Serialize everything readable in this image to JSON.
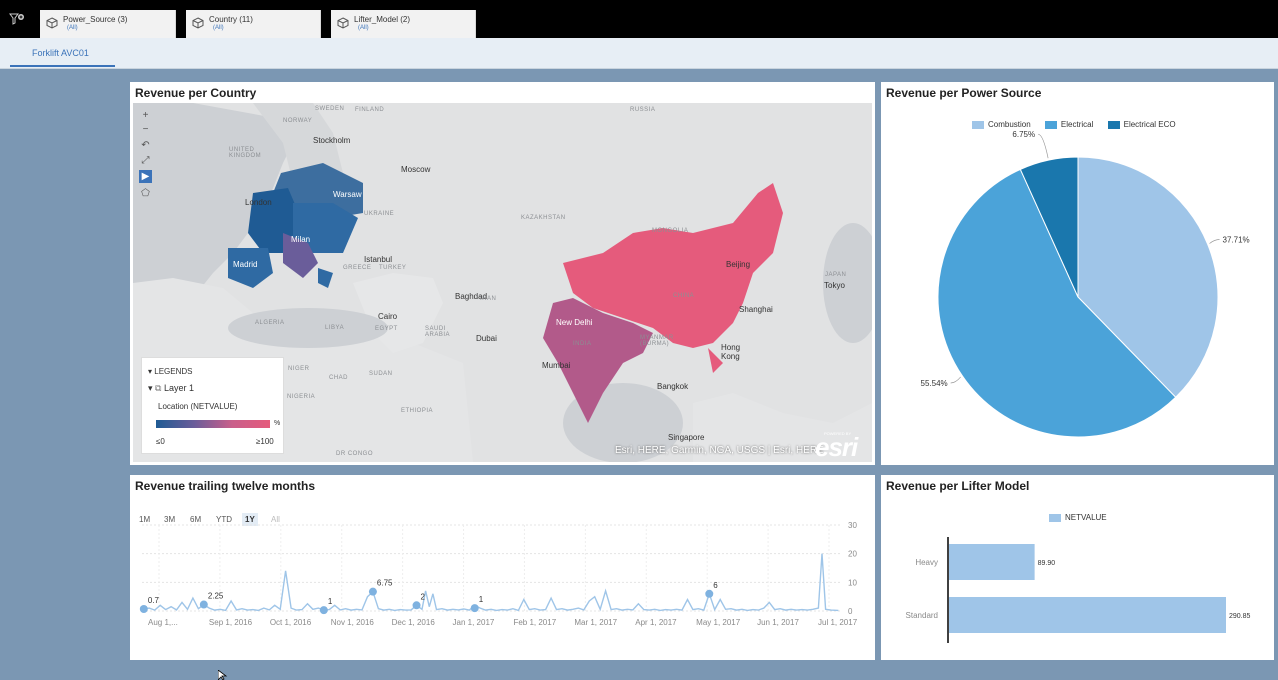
{
  "filters": [
    {
      "name": "Power_Source (3)",
      "value": "(All)"
    },
    {
      "name": "Country (11)",
      "value": "(All)"
    },
    {
      "name": "Lifter_Model (2)",
      "value": "(All)"
    }
  ],
  "tabs": [
    {
      "label": "Forklift AVC01"
    }
  ],
  "map_panel": {
    "title": "Revenue per Country",
    "labels": {
      "sweden": "SWEDEN",
      "finland": "FINLAND",
      "norway": "NORWAY",
      "russia": "RUSSIA",
      "stockholm": "Stockholm",
      "uk": "UNITED KINGDOM",
      "moscow": "Moscow",
      "london": "London",
      "warsaw": "Warsaw",
      "ukraine": "UKRAINE",
      "kazakhstan": "KAZAKHSTAN",
      "mongolia": "MONGOLIA",
      "milan": "Milan",
      "madrid": "Madrid",
      "greece": "GREECE",
      "turkey": "TURKEY",
      "istanbul": "Istanbul",
      "beijing": "Beijing",
      "japan": "JAPAN",
      "tokyo": "Tokyo",
      "baghdad": "Baghdad",
      "iran": "IRAN",
      "algeria": "ALGERIA",
      "libya": "LIBYA",
      "egypt": "EGYPT",
      "cairo": "Cairo",
      "saudi": "SAUDI ARABIA",
      "dubai": "Dubai",
      "china": "CHINA",
      "newdelhi": "New Delhi",
      "shanghai": "Shanghai",
      "india": "INDIA",
      "myanmar": "MYANMAR (BURMA)",
      "hongkong": "Hong Kong",
      "mumbai": "Mumbai",
      "niger": "NIGER",
      "chad": "CHAD",
      "sudan": "SUDAN",
      "nigeria": "NIGERIA",
      "bangkok": "Bangkok",
      "ethiopia": "ETHIOPIA",
      "singapore": "Singapore",
      "drcongo": "DR CONGO"
    },
    "legend": {
      "header": "LEGENDS",
      "layer": "Layer 1",
      "measure": "Location (NETVALUE)",
      "unit": "%",
      "min_label": "≤0",
      "max_label": "≥100"
    },
    "attribution": "Esri, HERE, Garmin, NGA, USGS | Esri, HERE",
    "logo": "esri",
    "powered_by": "POWERED BY",
    "colors": {
      "low": "#1f5b94",
      "mid": "#a05a8c",
      "high": "#e55b7c"
    }
  },
  "pie_panel": {
    "title": "Revenue per Power Source",
    "chart_data": {
      "type": "pie",
      "categories": [
        "Combustion",
        "Electrical",
        "Electrical ECO"
      ],
      "values": [
        37.71,
        55.54,
        6.75
      ],
      "labels": [
        "37.71%",
        "55.54%",
        "6.75%"
      ],
      "colors": [
        "#9fc5e8",
        "#4ba3d9",
        "#1a77ad"
      ],
      "legend_position": "top"
    }
  },
  "trend_panel": {
    "title": "Revenue trailing twelve months",
    "range_buttons": [
      {
        "label": "1M",
        "state": "normal"
      },
      {
        "label": "3M",
        "state": "normal"
      },
      {
        "label": "6M",
        "state": "normal"
      },
      {
        "label": "YTD",
        "state": "normal"
      },
      {
        "label": "1Y",
        "state": "selected"
      },
      {
        "label": "All",
        "state": "disabled"
      }
    ],
    "chart_data": {
      "type": "line",
      "x_tick_labels": [
        "Aug 1,...",
        "Sep 1, 2016",
        "Oct 1, 2016",
        "Nov 1, 2016",
        "Dec 1, 2016",
        "Jan 1, 2017",
        "Feb 1, 2017",
        "Mar 1, 2017",
        "Apr 1, 2017",
        "May 1, 2017",
        "Jun 1, 2017",
        "Jul 1, 2017"
      ],
      "y_ticks": [
        0,
        10,
        20,
        30
      ],
      "ylim": [
        0,
        30
      ],
      "xlim": [
        "2016-07-31",
        "2017-08-20"
      ],
      "grid": true,
      "color": "#9fc5e8",
      "series": [
        {
          "points": [
            [
              "2016-08-01",
              0.7
            ],
            [
              "2016-08-04",
              1
            ],
            [
              "2016-08-07",
              0.3
            ],
            [
              "2016-08-10",
              2
            ],
            [
              "2016-08-13",
              0.5
            ],
            [
              "2016-08-16",
              1.5
            ],
            [
              "2016-08-19",
              0.4
            ],
            [
              "2016-08-22",
              3
            ],
            [
              "2016-08-25",
              0.6
            ],
            [
              "2016-08-28",
              4.5
            ],
            [
              "2016-08-31",
              0.8
            ],
            [
              "2016-09-03",
              2.25
            ],
            [
              "2016-09-06",
              1
            ],
            [
              "2016-09-09",
              0.3
            ],
            [
              "2016-09-12",
              0.6
            ],
            [
              "2016-09-15",
              0.2
            ],
            [
              "2016-09-18",
              3.5
            ],
            [
              "2016-09-21",
              0.4
            ],
            [
              "2016-09-24",
              0.8
            ],
            [
              "2016-09-27",
              0.3
            ],
            [
              "2016-09-30",
              0.5
            ],
            [
              "2016-10-03",
              0.2
            ],
            [
              "2016-10-06",
              1
            ],
            [
              "2016-10-09",
              0.4
            ],
            [
              "2016-10-12",
              2
            ],
            [
              "2016-10-15",
              0.6
            ],
            [
              "2016-10-18",
              14
            ],
            [
              "2016-10-21",
              1
            ],
            [
              "2016-10-24",
              0.3
            ],
            [
              "2016-10-27",
              0.5
            ],
            [
              "2016-10-30",
              2.5
            ],
            [
              "2016-11-02",
              0.6
            ],
            [
              "2016-11-05",
              1
            ],
            [
              "2016-11-08",
              0.3
            ],
            [
              "2016-11-11",
              0.5
            ],
            [
              "2016-11-14",
              2
            ],
            [
              "2016-11-17",
              0.4
            ],
            [
              "2016-11-20",
              0.8
            ],
            [
              "2016-11-23",
              0.3
            ],
            [
              "2016-11-26",
              0.6
            ],
            [
              "2016-11-29",
              0.4
            ],
            [
              "2016-12-02",
              5
            ],
            [
              "2016-12-05",
              6.75
            ],
            [
              "2016-12-08",
              0.8
            ],
            [
              "2016-12-11",
              0.3
            ],
            [
              "2016-12-14",
              0.6
            ],
            [
              "2016-12-17",
              0.2
            ],
            [
              "2016-12-20",
              0.5
            ],
            [
              "2016-12-23",
              0.3
            ],
            [
              "2016-12-26",
              0.4
            ],
            [
              "2016-12-29",
              2
            ],
            [
              "2017-01-01",
              0.6
            ],
            [
              "2017-01-03",
              7
            ],
            [
              "2017-01-05",
              1.5
            ],
            [
              "2017-01-07",
              6
            ],
            [
              "2017-01-09",
              0.5
            ],
            [
              "2017-01-12",
              0.8
            ],
            [
              "2017-01-15",
              0.3
            ],
            [
              "2017-01-18",
              0.6
            ],
            [
              "2017-01-21",
              0.4
            ],
            [
              "2017-01-24",
              0.7
            ],
            [
              "2017-01-27",
              0.3
            ],
            [
              "2017-01-30",
              2
            ],
            [
              "2017-02-02",
              1
            ],
            [
              "2017-02-05",
              0.3
            ],
            [
              "2017-02-08",
              0.6
            ],
            [
              "2017-02-11",
              0.2
            ],
            [
              "2017-02-14",
              0.5
            ],
            [
              "2017-02-17",
              0.3
            ],
            [
              "2017-02-20",
              0.8
            ],
            [
              "2017-02-23",
              0.2
            ],
            [
              "2017-02-26",
              4
            ],
            [
              "2017-03-01",
              0.5
            ],
            [
              "2017-03-04",
              0.8
            ],
            [
              "2017-03-07",
              0.3
            ],
            [
              "2017-03-10",
              0.5
            ],
            [
              "2017-03-13",
              4.5
            ],
            [
              "2017-03-16",
              0.5
            ],
            [
              "2017-03-19",
              0.8
            ],
            [
              "2017-03-22",
              0.3
            ],
            [
              "2017-03-25",
              0.6
            ],
            [
              "2017-03-28",
              1
            ],
            [
              "2017-03-31",
              0.4
            ],
            [
              "2017-04-03",
              3.5
            ],
            [
              "2017-04-06",
              5
            ],
            [
              "2017-04-09",
              0.6
            ],
            [
              "2017-04-12",
              7
            ],
            [
              "2017-04-15",
              0.5
            ],
            [
              "2017-04-18",
              0.8
            ],
            [
              "2017-04-21",
              0.3
            ],
            [
              "2017-04-24",
              0.6
            ],
            [
              "2017-04-27",
              0.4
            ],
            [
              "2017-04-30",
              2.5
            ],
            [
              "2017-05-03",
              0.5
            ],
            [
              "2017-05-06",
              0.3
            ],
            [
              "2017-05-09",
              0.6
            ],
            [
              "2017-05-12",
              0.2
            ],
            [
              "2017-05-15",
              0.5
            ],
            [
              "2017-05-18",
              0.3
            ],
            [
              "2017-05-21",
              0.6
            ],
            [
              "2017-05-24",
              0.3
            ],
            [
              "2017-05-27",
              4
            ],
            [
              "2017-05-30",
              0.5
            ],
            [
              "2017-06-02",
              0.8
            ],
            [
              "2017-06-05",
              0.3
            ],
            [
              "2017-06-08",
              6
            ],
            [
              "2017-06-11",
              0.5
            ],
            [
              "2017-06-14",
              4
            ],
            [
              "2017-06-17",
              0.6
            ],
            [
              "2017-06-20",
              0.8
            ],
            [
              "2017-06-23",
              0.3
            ],
            [
              "2017-06-26",
              0.6
            ],
            [
              "2017-06-29",
              0.2
            ],
            [
              "2017-07-02",
              0.5
            ],
            [
              "2017-07-05",
              0.3
            ],
            [
              "2017-07-08",
              1
            ],
            [
              "2017-07-11",
              3
            ],
            [
              "2017-07-14",
              0.5
            ],
            [
              "2017-07-17",
              0.8
            ],
            [
              "2017-07-20",
              0.3
            ],
            [
              "2017-07-23",
              0.6
            ],
            [
              "2017-07-26",
              0.3
            ],
            [
              "2017-07-29",
              0.5
            ],
            [
              "2017-08-01",
              0.3
            ],
            [
              "2017-08-04",
              0.6
            ],
            [
              "2017-08-07",
              1
            ],
            [
              "2017-08-09",
              20
            ],
            [
              "2017-08-11",
              0.6
            ],
            [
              "2017-08-14",
              0.3
            ],
            [
              "2017-08-18",
              0.2
            ]
          ]
        }
      ],
      "labeled_points": [
        {
          "x": "2016-08-01",
          "y": 0.7,
          "label": "0.7"
        },
        {
          "x": "2016-09-03",
          "y": 2.25,
          "label": "2.25"
        },
        {
          "x": "2016-11-08",
          "y": 0.3,
          "label": "1"
        },
        {
          "x": "2016-12-05",
          "y": 6.75,
          "label": "6.75"
        },
        {
          "x": "2016-12-29",
          "y": 2,
          "label": "2"
        },
        {
          "x": "2017-01-30",
          "y": 1,
          "label": "1"
        },
        {
          "x": "2017-06-08",
          "y": 6,
          "label": "6"
        }
      ]
    }
  },
  "bar_panel": {
    "title": "Revenue per Lifter Model",
    "chart_data": {
      "type": "bar",
      "orientation": "horizontal",
      "categories": [
        "Heavy",
        "Standard"
      ],
      "series": [
        {
          "name": "NETVALUE",
          "values": [
            89.9,
            290.85
          ]
        }
      ],
      "value_labels": [
        "89.90",
        "290.85"
      ],
      "color": "#9fc5e8",
      "legend_position": "top"
    }
  }
}
